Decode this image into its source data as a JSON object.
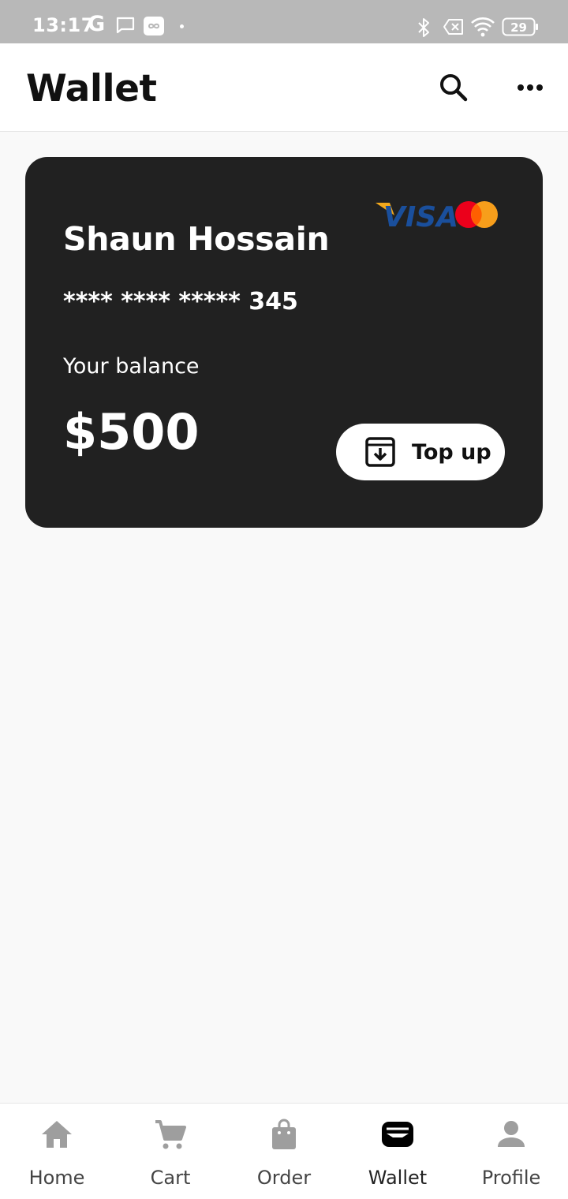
{
  "status_bar": {
    "time": "13:17",
    "google_letter": "G",
    "battery": "29"
  },
  "app_bar": {
    "title": "Wallet",
    "icons": [
      "search-icon",
      "more-horizontal-icon"
    ]
  },
  "card": {
    "holder_name": "Shaun Hossain",
    "number": "**** **** ***** 345",
    "balance_label": "Your balance",
    "balance": "$500",
    "topup_label": "Top up",
    "brands": [
      "VISA",
      "Mastercard"
    ],
    "colors": {
      "background": "#212121",
      "visa_blue": "#1a4f9c",
      "visa_gold": "#f2a81d",
      "mc_red": "#eb001b",
      "mc_orange": "#f79e1b"
    }
  },
  "bottom_nav": {
    "active": "Wallet",
    "items": [
      {
        "label": "Home",
        "icon": "home-icon"
      },
      {
        "label": "Cart",
        "icon": "cart-icon"
      },
      {
        "label": "Order",
        "icon": "shopping-bag-icon"
      },
      {
        "label": "Wallet",
        "icon": "wallet-icon"
      },
      {
        "label": "Profile",
        "icon": "person-icon"
      }
    ],
    "colors": {
      "active": "#000000",
      "inactive": "#9e9e9e"
    }
  }
}
